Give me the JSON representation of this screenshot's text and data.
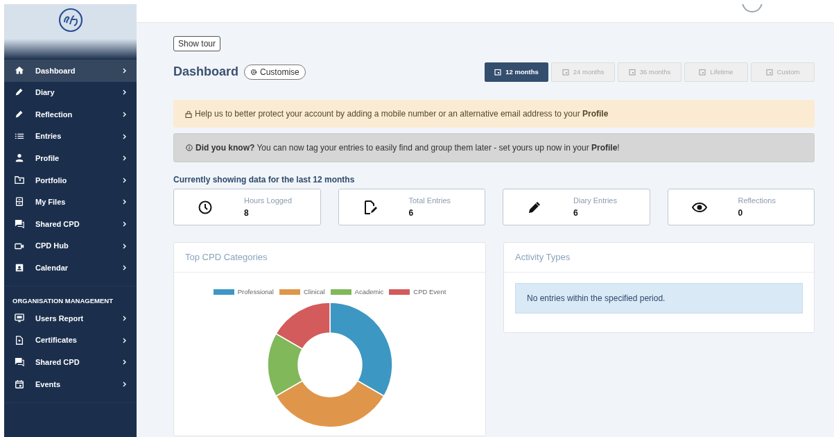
{
  "sidebar": {
    "items": [
      {
        "label": "Dashboard",
        "selected": true
      },
      {
        "label": "Diary",
        "selected": false
      },
      {
        "label": "Reflection",
        "selected": false
      },
      {
        "label": "Entries",
        "selected": false
      },
      {
        "label": "Profile",
        "selected": false
      },
      {
        "label": "Portfolio",
        "selected": false
      },
      {
        "label": "My Files",
        "selected": false
      },
      {
        "label": "Shared CPD",
        "selected": false
      },
      {
        "label": "CPD Hub",
        "selected": false
      },
      {
        "label": "Calendar",
        "selected": false
      }
    ],
    "section_title": "ORGANISATION MANAGEMENT",
    "org_items": [
      {
        "label": "Users Report",
        "selected": false
      },
      {
        "label": "Certificates",
        "selected": false
      },
      {
        "label": "Shared CPD",
        "selected": false
      },
      {
        "label": "Events",
        "selected": false
      }
    ]
  },
  "show_tour": "Show tour",
  "title": "Dashboard",
  "customise": "Customise",
  "periods": [
    {
      "label": "12 months",
      "selected": true
    },
    {
      "label": "24 months",
      "selected": false
    },
    {
      "label": "36 months",
      "selected": false
    },
    {
      "label": "Lifetime",
      "selected": false
    },
    {
      "label": "Custom",
      "selected": false
    }
  ],
  "alerts": [
    {
      "kind": "warning",
      "text": "Help us to better protect your account by adding a mobile number or an alternative email address to your **Profile**"
    },
    {
      "kind": "info",
      "text": "**Did you know?** You can now tag your entries to easily find and group them later - set yours up now in your **Profile**!"
    }
  ],
  "showing_text": "Currently showing data for the last 12 months",
  "stats": [
    {
      "label": "Hours Logged",
      "value": "8"
    },
    {
      "label": "Total Entries",
      "value": "6"
    },
    {
      "label": "Diary Entries",
      "value": "6"
    },
    {
      "label": "Reflections",
      "value": "0"
    }
  ],
  "categories_card": {
    "title": "Top CPD Categories",
    "legend": [
      {
        "label": "Professional",
        "color": "#3d97c3"
      },
      {
        "label": "Clinical",
        "color": "#e0964a"
      },
      {
        "label": "Academic",
        "color": "#80b85a"
      },
      {
        "label": "CPD Event",
        "color": "#d35b5b"
      }
    ]
  },
  "activity_card": {
    "title": "Activity Types",
    "message": "No entries within the specified period."
  }
}
